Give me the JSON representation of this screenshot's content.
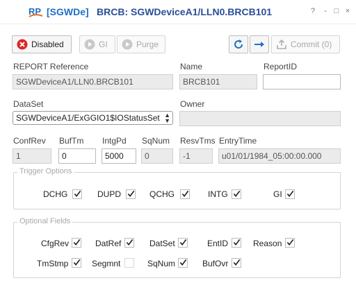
{
  "window": {
    "logo_text": "RP",
    "title_bracket": "[SGWDe]",
    "title_main": "BRCB: SGWDeviceA1/LLN0.BRCB101",
    "controls": {
      "help": "?",
      "minimize": "-",
      "maximize": "□",
      "close": "×"
    }
  },
  "toolbar": {
    "disabled_label": "Disabled",
    "gi_label": "GI",
    "purge_label": "Purge",
    "commit_label": "Commit (0)"
  },
  "fields": {
    "report_reference": {
      "label": "REPORT Reference",
      "value": "SGWDeviceA1/LLN0.BRCB101"
    },
    "name": {
      "label": "Name",
      "value": "BRCB101"
    },
    "report_id": {
      "label": "ReportID",
      "value": ""
    },
    "dataset": {
      "label": "DataSet",
      "value": "SGWDeviceA1/ExGGIO1$IOStatusSet"
    },
    "owner": {
      "label": "Owner",
      "value": ""
    },
    "conf_rev": {
      "label": "ConfRev",
      "value": "1"
    },
    "buf_tm": {
      "label": "BufTm",
      "value": "0"
    },
    "intg_pd": {
      "label": "IntgPd",
      "value": "5000"
    },
    "sq_num": {
      "label": "SqNum",
      "value": "0"
    },
    "resv_tms": {
      "label": "ResvTms",
      "value": "-1"
    },
    "entry_time": {
      "label": "EntryTime",
      "value": "u01/01/1984_05:00:00.000"
    }
  },
  "trigger_options": {
    "title": "Trigger Options",
    "items": [
      {
        "label": "DCHG",
        "checked": true
      },
      {
        "label": "DUPD",
        "checked": true
      },
      {
        "label": "QCHG",
        "checked": true
      },
      {
        "label": "INTG",
        "checked": true
      },
      {
        "label": "GI",
        "checked": true
      }
    ]
  },
  "optional_fields": {
    "title": "Optional Fields",
    "items": [
      {
        "label": "CfgRev",
        "checked": true
      },
      {
        "label": "DatRef",
        "checked": true
      },
      {
        "label": "DatSet",
        "checked": true
      },
      {
        "label": "EntID",
        "checked": true
      },
      {
        "label": "Reason",
        "checked": true
      },
      {
        "label": "TmStmp",
        "checked": true
      },
      {
        "label": "Segmnt",
        "checked": false
      },
      {
        "label": "SqNum",
        "checked": true
      },
      {
        "label": "BufOvr",
        "checked": true
      }
    ]
  },
  "colors": {
    "accent": "#1f6fc5",
    "title": "#2a4e9a",
    "disabled_red": "#e02424",
    "inactive": "#a8a8a8"
  },
  "icons": {
    "logo": "rp-logo",
    "disabled": "stop-x-icon",
    "gi": "play-icon",
    "purge": "play-icon",
    "refresh": "refresh-icon",
    "arrow": "arrow-right-icon",
    "commit": "upload-icon"
  }
}
